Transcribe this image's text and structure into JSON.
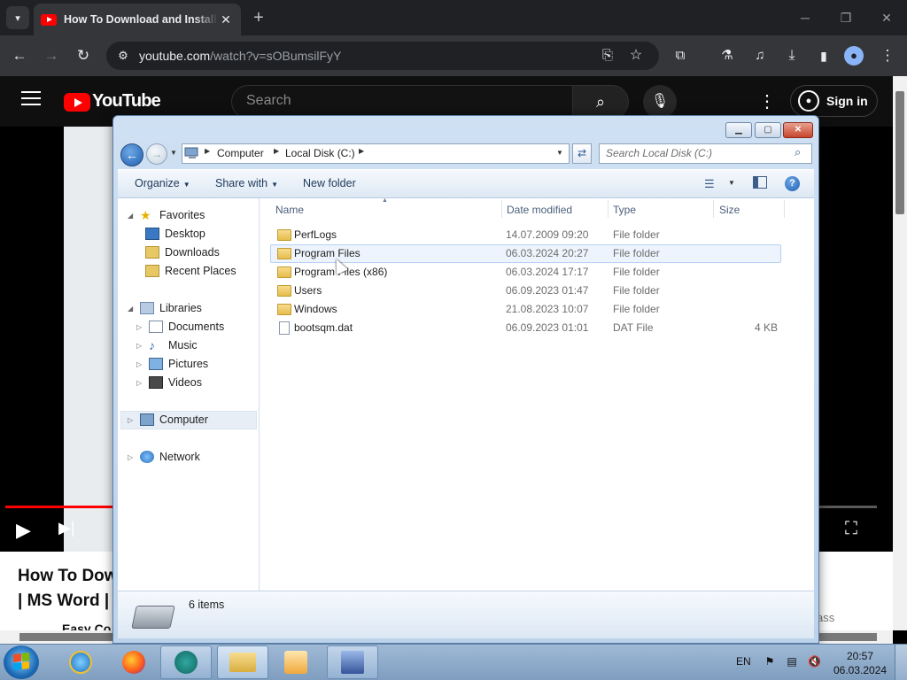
{
  "browser": {
    "tab_title": "How To Download and Install |",
    "tab_close": "✕",
    "new_tab": "+",
    "url_host": "youtube.com",
    "url_path": "/watch?v=sOBumsilFyY"
  },
  "youtube": {
    "logo_text": "YouTube",
    "search_placeholder": "Search",
    "sign_in": "Sign in",
    "video_title_line1": "How To Dow",
    "video_title_line2": "| MS Word |",
    "channel_snip": "Easy Co",
    "right_snip": "ass",
    "progress_fraction": 0.124
  },
  "explorer": {
    "breadcrumb": [
      "Computer",
      "Local Disk (C:)"
    ],
    "search_placeholder": "Search Local Disk (C:)",
    "commands": {
      "organize": "Organize",
      "share_with": "Share with",
      "new_folder": "New folder"
    },
    "nav": {
      "favorites": "Favorites",
      "desktop": "Desktop",
      "downloads": "Downloads",
      "recent_places": "Recent Places",
      "libraries": "Libraries",
      "documents": "Documents",
      "music": "Music",
      "pictures": "Pictures",
      "videos": "Videos",
      "computer": "Computer",
      "network": "Network"
    },
    "columns": {
      "name": "Name",
      "date": "Date modified",
      "type": "Type",
      "size": "Size"
    },
    "rows": [
      {
        "name": "PerfLogs",
        "date": "14.07.2009 09:20",
        "type": "File folder",
        "size": ""
      },
      {
        "name": "Program Files",
        "date": "06.03.2024 20:27",
        "type": "File folder",
        "size": ""
      },
      {
        "name": "Program Files (x86)",
        "date": "06.03.2024 17:17",
        "type": "File folder",
        "size": ""
      },
      {
        "name": "Users",
        "date": "06.09.2023 01:47",
        "type": "File folder",
        "size": ""
      },
      {
        "name": "Windows",
        "date": "21.08.2023 10:07",
        "type": "File folder",
        "size": ""
      },
      {
        "name": "bootsqm.dat",
        "date": "06.09.2023 01:01",
        "type": "DAT File",
        "size": "4 KB"
      }
    ],
    "item_count": "6 items"
  },
  "taskbar": {
    "lang": "EN",
    "time": "20:57",
    "date": "06.03.2024"
  },
  "colors": {
    "youtube_red": "#ff0000",
    "chrome_dark": "#202124",
    "explorer_chrome": "#bcd3ec",
    "taskbar": "#8fabc9"
  }
}
